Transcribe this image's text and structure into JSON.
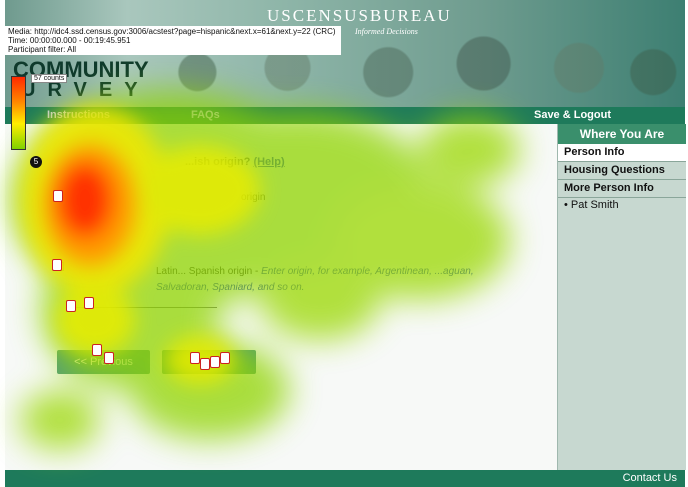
{
  "header": {
    "bureau_title": "USCENSUSBUREAU",
    "tagline": "Informed Decisions",
    "media_line": "Media: http://idc4.ssd.census.gov:3006/acstest?page=hispanic&next.x=61&next.y=22 (CRC)",
    "time_line": "Time: 00:00:00.000 - 00:19:45.951",
    "participant_line": "Participant filter: All",
    "logo_line1": "COMMUNITY",
    "logo_line2": "URVEY"
  },
  "nav": {
    "instructions": "Instructions",
    "faqs": "FAQs",
    "save_logout": "Save & Logout"
  },
  "sidebar": {
    "heading": "Where You Are",
    "items": [
      {
        "label": "Person Info",
        "active": true
      },
      {
        "label": "Housing Questions",
        "active": false
      },
      {
        "label": "More Person Info",
        "active": false
      }
    ],
    "sub_item": "• Pat Smith"
  },
  "question": {
    "title": "...ish origin?",
    "help": "(Help)",
    "option1": "origin",
    "option2_prefix": "Latin... Spanish origin - ",
    "option2_hint": "Enter origin, for example, Argentinean, ...aguan, Salvadoran, Spaniard, and so on."
  },
  "buttons": {
    "previous": "<< Previous",
    "next": ""
  },
  "footer": {
    "contact": "Contact Us"
  },
  "heatmap": {
    "legend_counts": "57 counts",
    "marker_label": "5",
    "colors": {
      "hot": "#ff2a00",
      "warm": "#ff9900",
      "medium": "#ffee00",
      "cool": "#7fd200"
    }
  }
}
